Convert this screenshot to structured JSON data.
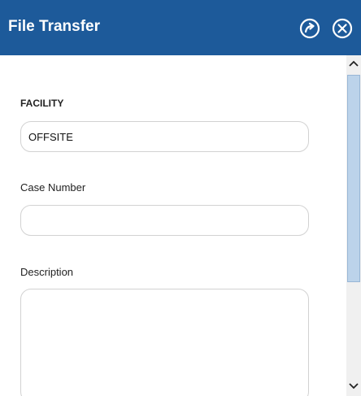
{
  "window": {
    "title": "File Transfer"
  },
  "header": {
    "popout_icon": "popout-arrow-circle-icon",
    "close_icon": "close-circle-icon"
  },
  "form": {
    "facility": {
      "label": "FACILITY",
      "value": "OFFSITE"
    },
    "case_number": {
      "label": "Case Number",
      "value": ""
    },
    "description": {
      "label": "Description",
      "value": ""
    }
  },
  "scrollbar": {
    "up_icon": "chevron-up-icon",
    "down_icon": "chevron-down-icon"
  },
  "colors": {
    "titlebar": "#1d5a9a",
    "scroll_thumb": "#bcd3ea",
    "input_border": "#d2d2d2"
  }
}
